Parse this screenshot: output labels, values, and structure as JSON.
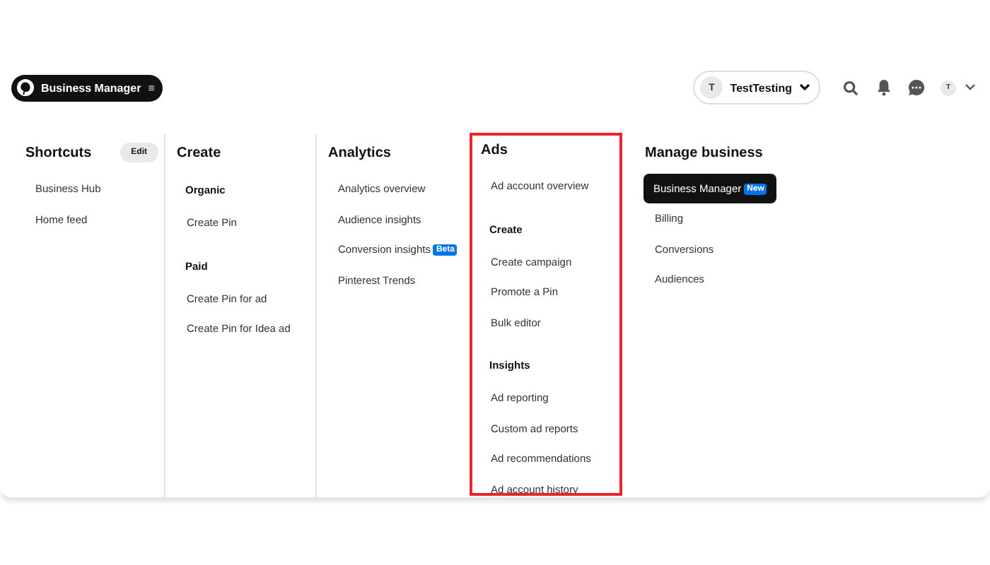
{
  "topbar": {
    "menu_button": {
      "label": "Business Manager",
      "menu_glyph": "≡"
    },
    "account": {
      "initial": "T",
      "name": "TestTesting"
    },
    "avatar_initial": "T"
  },
  "columns": [
    {
      "title": "Shortcuts",
      "edit": "Edit",
      "highlighted": false,
      "groups": [
        {
          "items": [
            {
              "label": "Business Hub",
              "selected": false
            },
            {
              "label": "Home feed",
              "selected": false
            }
          ]
        }
      ]
    },
    {
      "title": "Create",
      "highlighted": false,
      "groups": [
        {
          "heading": "Organic",
          "items": [
            {
              "label": "Create Pin",
              "selected": false
            }
          ]
        },
        {
          "heading": "Paid",
          "items": [
            {
              "label": "Create Pin for ad",
              "selected": false
            },
            {
              "label": "Create Pin for Idea ad",
              "selected": false
            }
          ]
        }
      ]
    },
    {
      "title": "Analytics",
      "highlighted": false,
      "groups": [
        {
          "items": [
            {
              "label": "Analytics overview",
              "selected": false
            },
            {
              "label": "Audience insights",
              "selected": false
            },
            {
              "label": "Conversion insights",
              "badge": "Beta",
              "selected": false
            },
            {
              "label": "Pinterest Trends",
              "selected": false
            }
          ]
        }
      ]
    },
    {
      "title": "Ads",
      "highlighted": true,
      "groups": [
        {
          "items": [
            {
              "label": "Ad account overview",
              "selected": false
            }
          ]
        },
        {
          "heading": "Create",
          "items": [
            {
              "label": "Create campaign",
              "selected": false
            },
            {
              "label": "Promote a Pin",
              "selected": false
            },
            {
              "label": "Bulk editor",
              "selected": false
            }
          ]
        },
        {
          "heading": "Insights",
          "items": [
            {
              "label": "Ad reporting",
              "selected": false
            },
            {
              "label": "Custom ad reports",
              "selected": false
            },
            {
              "label": "Ad recommendations",
              "selected": false
            },
            {
              "label": "Ad account history",
              "selected": false
            }
          ]
        }
      ]
    },
    {
      "title": "Manage business",
      "highlighted": false,
      "groups": [
        {
          "items": [
            {
              "label": "Business Manager",
              "badge": "New",
              "selected": true
            },
            {
              "label": "Billing",
              "selected": false
            },
            {
              "label": "Conversions",
              "selected": false
            },
            {
              "label": "Audiences",
              "selected": false
            }
          ]
        }
      ]
    }
  ]
}
